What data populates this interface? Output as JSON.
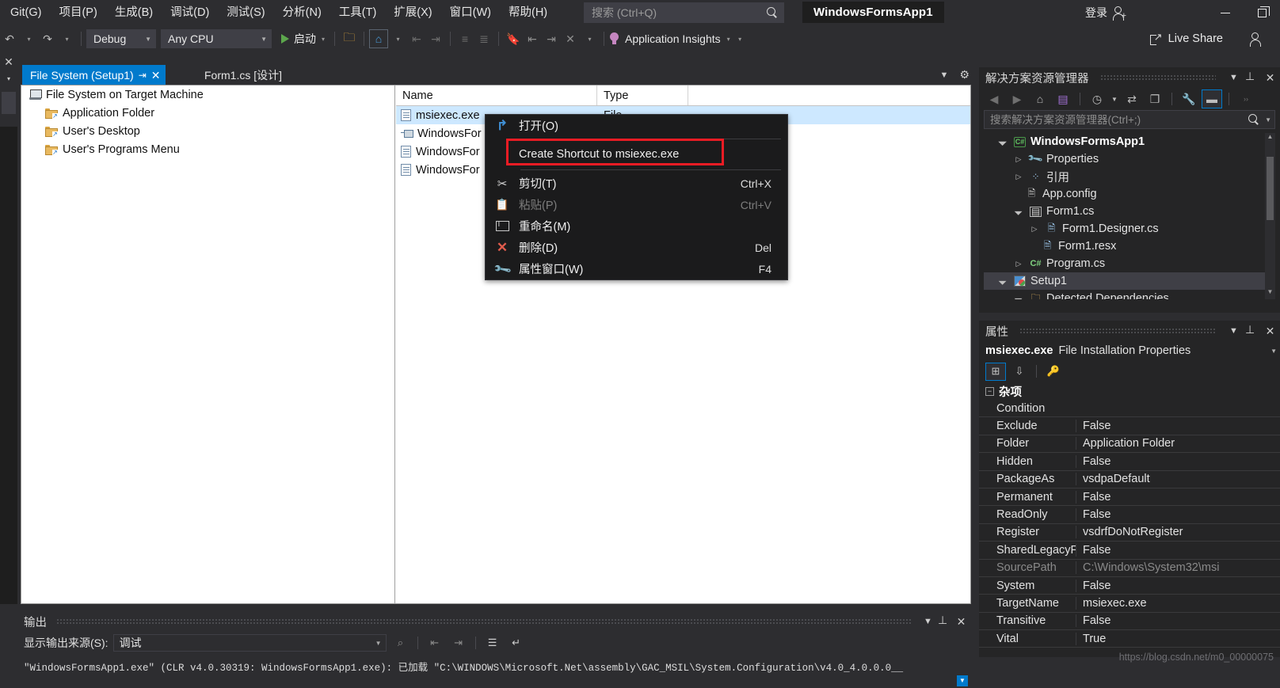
{
  "titlebar": {
    "menu": [
      "Git(G)",
      "项目(P)",
      "生成(B)",
      "调试(D)",
      "测试(S)",
      "分析(N)",
      "工具(T)",
      "扩展(X)",
      "窗口(W)",
      "帮助(H)"
    ],
    "search_placeholder": "搜索 (Ctrl+Q)",
    "search_value": "",
    "app_title": "WindowsFormsApp1",
    "signin_label": "登录",
    "minimize_tip": "—",
    "restore_tip": "❐"
  },
  "toolbar": {
    "config_value": "Debug",
    "platform_value": "Any CPU",
    "start_label": "启动",
    "app_insights_label": "Application Insights",
    "live_share_label": "Live Share"
  },
  "tabs": [
    {
      "label": "File System (Setup1)",
      "active": true
    },
    {
      "label": "Form1.cs [设计]",
      "active": false
    }
  ],
  "designer": {
    "tree": [
      {
        "label": "File System on Target Machine",
        "icon": "computer-icon",
        "level": 0
      },
      {
        "label": "Application Folder",
        "icon": "folder-icon",
        "level": 1
      },
      {
        "label": "User's Desktop",
        "icon": "folder-icon",
        "level": 1
      },
      {
        "label": "User's Programs Menu",
        "icon": "folder-icon",
        "level": 1
      }
    ],
    "columns": [
      "Name",
      "Type"
    ],
    "rows": [
      {
        "name": "msiexec.exe",
        "type": "File",
        "icon": "file-icon",
        "selected": true
      },
      {
        "name": "WindowsFor",
        "type": "",
        "icon": "shortcut-icon",
        "selected": false
      },
      {
        "name": "WindowsFor",
        "type": "",
        "icon": "file-icon",
        "selected": false
      },
      {
        "name": "WindowsFor",
        "type": "",
        "icon": "file-icon",
        "selected": false
      }
    ]
  },
  "context_menu": {
    "highlight_color": "#ec1c24",
    "items": [
      {
        "label": "打开(O)",
        "shortcut": "",
        "icon": "open-arrow-icon",
        "disabled": false
      },
      {
        "label": "Create Shortcut to msiexec.exe",
        "shortcut": "",
        "icon": "",
        "disabled": false,
        "highlighted": true
      },
      {
        "label": "剪切(T)",
        "shortcut": "Ctrl+X",
        "icon": "scissors-icon",
        "disabled": false
      },
      {
        "label": "粘贴(P)",
        "shortcut": "Ctrl+V",
        "icon": "paste-icon",
        "disabled": true
      },
      {
        "label": "重命名(M)",
        "shortcut": "",
        "icon": "rename-icon",
        "disabled": false
      },
      {
        "label": "删除(D)",
        "shortcut": "Del",
        "icon": "delete-icon",
        "disabled": false
      },
      {
        "label": "属性窗口(W)",
        "shortcut": "F4",
        "icon": "wrench-icon",
        "disabled": false
      }
    ]
  },
  "solution_explorer": {
    "title": "解决方案资源管理器",
    "search_placeholder": "搜索解决方案资源管理器(Ctrl+;)",
    "search_value": "",
    "tree": [
      {
        "label": "WindowsFormsApp1",
        "indent": 1,
        "expander": "open",
        "icon": "csharp-project-icon",
        "bold": true,
        "selected": false
      },
      {
        "label": "Properties",
        "indent": 2,
        "expander": "closed",
        "icon": "properties-icon",
        "bold": false,
        "selected": false
      },
      {
        "label": "引用",
        "indent": 2,
        "expander": "closed",
        "icon": "references-icon",
        "bold": false,
        "selected": false
      },
      {
        "label": "App.config",
        "indent": 3,
        "expander": "none",
        "icon": "config-file-icon",
        "bold": false,
        "selected": false
      },
      {
        "label": "Form1.cs",
        "indent": 2,
        "expander": "open",
        "icon": "form-icon",
        "bold": false,
        "selected": false
      },
      {
        "label": "Form1.Designer.cs",
        "indent": 3,
        "expander": "closed",
        "icon": "designer-file-icon",
        "bold": false,
        "selected": false
      },
      {
        "label": "Form1.resx",
        "indent": 4,
        "expander": "none",
        "icon": "resx-file-icon",
        "bold": false,
        "selected": false
      },
      {
        "label": "Program.cs",
        "indent": 2,
        "expander": "closed",
        "icon": "csharp-file-icon",
        "bold": false,
        "selected": false
      },
      {
        "label": "Setup1",
        "indent": 1,
        "expander": "open",
        "icon": "setup-project-icon",
        "bold": false,
        "selected": true
      },
      {
        "label": "Detected Dependencies",
        "indent": 2,
        "expander": "open",
        "icon": "folder-yellow-icon",
        "bold": false,
        "selected": false
      }
    ]
  },
  "properties": {
    "title": "属性",
    "object_name": "msiexec.exe",
    "object_type": "File Installation Properties",
    "category": "杂项",
    "rows": [
      {
        "key": "Condition",
        "value": "",
        "dim": false
      },
      {
        "key": "Exclude",
        "value": "False",
        "dim": false
      },
      {
        "key": "Folder",
        "value": "Application Folder",
        "dim": false
      },
      {
        "key": "Hidden",
        "value": "False",
        "dim": false
      },
      {
        "key": "PackageAs",
        "value": "vsdpaDefault",
        "dim": false
      },
      {
        "key": "Permanent",
        "value": "False",
        "dim": false
      },
      {
        "key": "ReadOnly",
        "value": "False",
        "dim": false
      },
      {
        "key": "Register",
        "value": "vsdrfDoNotRegister",
        "dim": false
      },
      {
        "key": "SharedLegacyF",
        "value": "False",
        "dim": false
      },
      {
        "key": "SourcePath",
        "value": "C:\\Windows\\System32\\msi",
        "dim": true
      },
      {
        "key": "System",
        "value": "False",
        "dim": false
      },
      {
        "key": "TargetName",
        "value": "msiexec.exe",
        "dim": false
      },
      {
        "key": "Transitive",
        "value": "False",
        "dim": false
      },
      {
        "key": "Vital",
        "value": "True",
        "dim": false
      }
    ]
  },
  "output": {
    "title": "输出",
    "source_label": "显示输出来源(S):",
    "source_value": "调试",
    "line": "\"WindowsFormsApp1.exe\" (CLR v4.0.30319: WindowsFormsApp1.exe): 已加载 \"C:\\WINDOWS\\Microsoft.Net\\assembly\\GAC_MSIL\\System.Configuration\\v4.0_4.0.0.0__"
  },
  "watermark": "https://blog.csdn.net/m0_00000075"
}
